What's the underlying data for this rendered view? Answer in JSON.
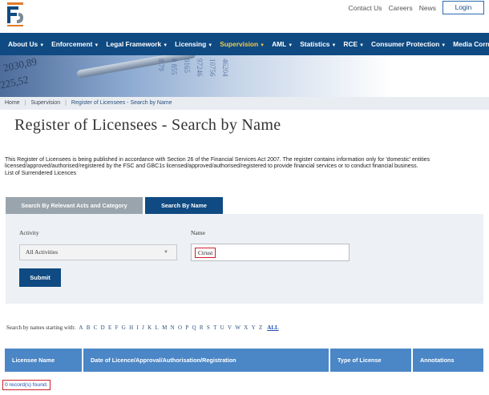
{
  "header": {
    "top_links": [
      "Contact Us",
      "Careers",
      "News"
    ],
    "login_label": "Login"
  },
  "nav": {
    "items": [
      {
        "label": "About Us",
        "active": false
      },
      {
        "label": "Enforcement",
        "active": false
      },
      {
        "label": "Legal Framework",
        "active": false
      },
      {
        "label": "Licensing",
        "active": false
      },
      {
        "label": "Supervision",
        "active": true
      },
      {
        "label": "AML",
        "active": false
      },
      {
        "label": "Statistics",
        "active": false
      },
      {
        "label": "RCE",
        "active": false
      },
      {
        "label": "Consumer Protection",
        "active": false
      },
      {
        "label": "Media Corner",
        "active": false
      }
    ]
  },
  "breadcrumb": {
    "home": "Home",
    "section": "Supervision",
    "current": "Register of Licensees - Search by Name"
  },
  "page": {
    "title": "Register of Licensees - Search by Name",
    "intro_line1": "This Register of Licensees is being published in accordance with Section 26 of the Financial Services Act 2007. The register contains information only for 'domestic' entities",
    "intro_line2": "licensed/approved/authorised/registered by the FSC and GBC1s licensed/approved/authorised/registered to provide financial services or to conduct financial business.",
    "surrendered_link": "List of Surrendered Licences"
  },
  "tabs": {
    "by_act_label": "Search By Relevant Acts and Category",
    "by_name_label": "Search By Name"
  },
  "form": {
    "activity_label": "Activity",
    "activity_value": "All Activities",
    "name_label": "Name",
    "name_value": "Ctrust",
    "submit_label": "Submit"
  },
  "alphabet": {
    "prefix": "Search by names starting with:",
    "letters": [
      "A",
      "B",
      "C",
      "D",
      "E",
      "F",
      "G",
      "H",
      "I",
      "J",
      "K",
      "L",
      "M",
      "N",
      "O",
      "P",
      "Q",
      "R",
      "S",
      "T",
      "U",
      "V",
      "W",
      "X",
      "Y",
      "Z"
    ],
    "all_label": "ALL"
  },
  "table": {
    "columns": [
      "Licensee Name",
      "Date of Licence/Approval/Authorisation/Registration",
      "Type of License",
      "Annotations"
    ]
  },
  "results": {
    "records_text": "0 record(s) found."
  },
  "colors": {
    "nav_bg": "#0f4a82",
    "nav_active": "#f2c94c",
    "table_header": "#4b86c6",
    "highlight_border": "#d0202a"
  }
}
